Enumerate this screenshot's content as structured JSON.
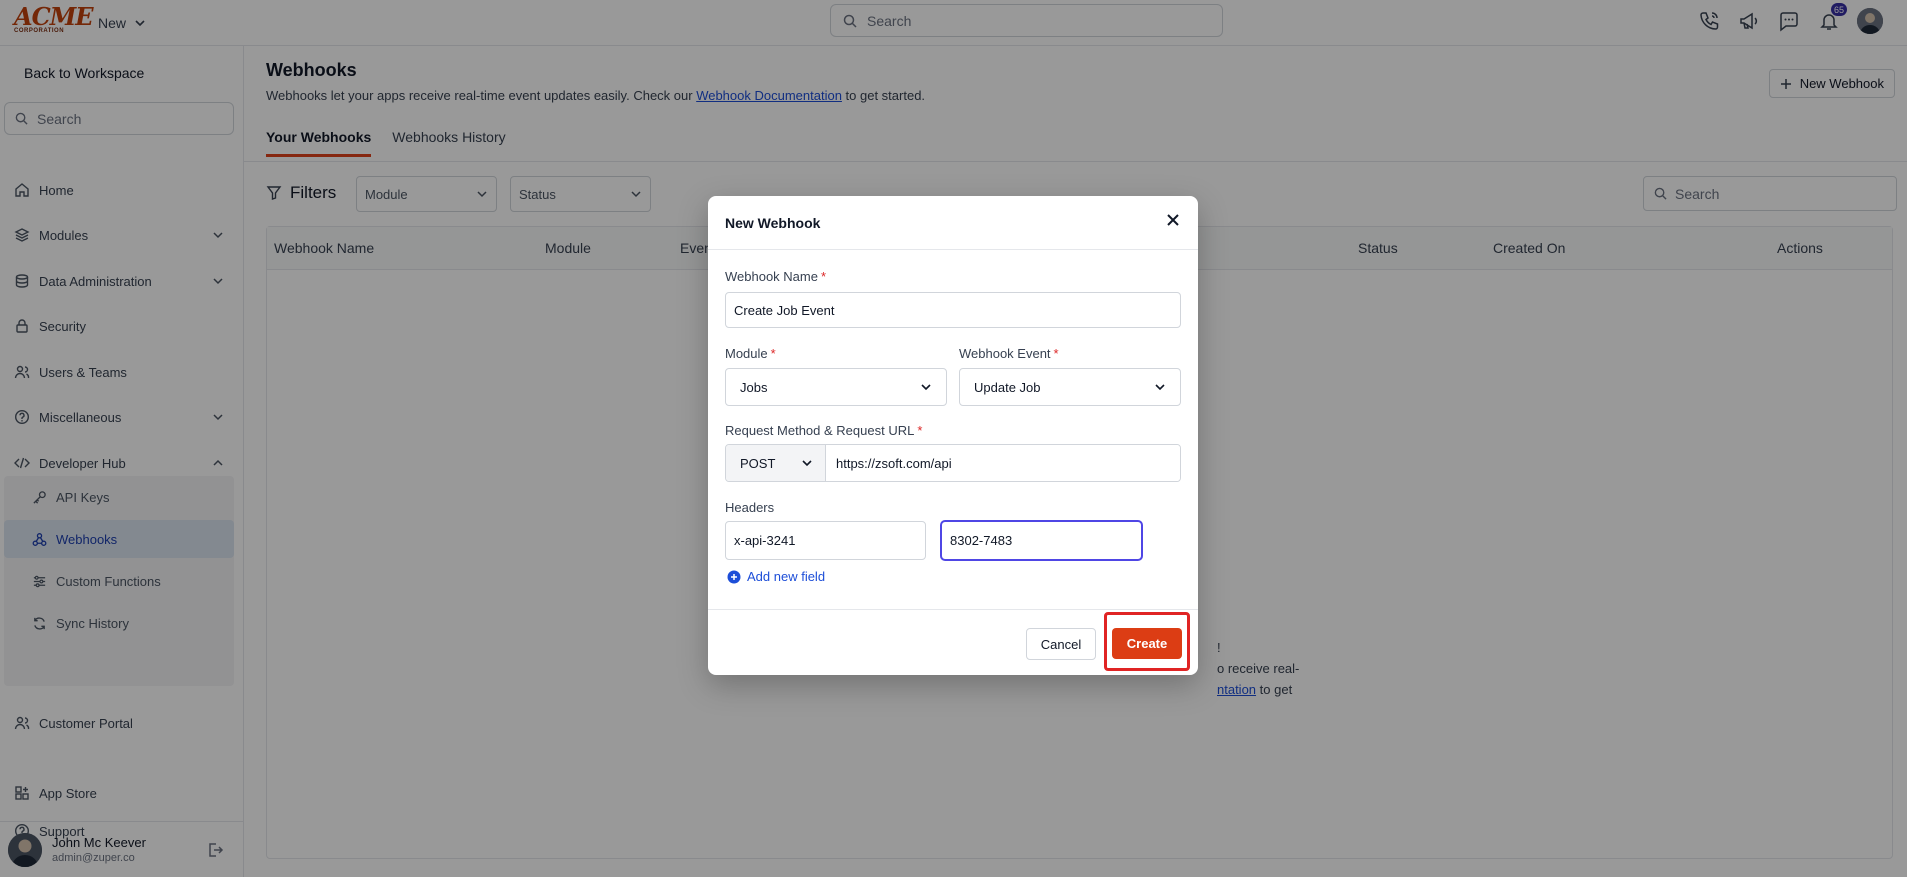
{
  "topbar": {
    "logo_main": "ACME",
    "logo_sub": "CORPORATION",
    "new_label": "New",
    "search_placeholder": "Search",
    "notification_count": "65"
  },
  "sidebar": {
    "back_label": "Back to Workspace",
    "search_placeholder": "Search",
    "items": [
      {
        "label": "Home"
      },
      {
        "label": "Modules"
      },
      {
        "label": "Data Administration"
      },
      {
        "label": "Security"
      },
      {
        "label": "Users & Teams"
      },
      {
        "label": "Miscellaneous"
      },
      {
        "label": "Developer Hub"
      },
      {
        "label": "Customer Portal"
      },
      {
        "label": "App Store"
      },
      {
        "label": "Support"
      }
    ],
    "sub_items": [
      {
        "label": "API Keys"
      },
      {
        "label": "Webhooks"
      },
      {
        "label": "Custom Functions"
      },
      {
        "label": "Sync History"
      }
    ],
    "user": {
      "name": "John Mc Keever",
      "email": "admin@zuper.co"
    }
  },
  "main": {
    "title": "Webhooks",
    "desc_pre": "Webhooks let your apps receive real-time event updates easily. Check our ",
    "desc_link": "Webhook Documentation",
    "desc_post": " to get started.",
    "new_button": "New Webhook",
    "tabs": [
      {
        "label": "Your Webhooks"
      },
      {
        "label": "Webhooks History"
      }
    ],
    "filters_label": "Filters",
    "filter_module": "Module",
    "filter_status": "Status",
    "search_placeholder": "Search",
    "columns": [
      "Webhook Name",
      "Module",
      "Event",
      "Status",
      "Created On",
      "Actions"
    ],
    "empty_line1": "!",
    "empty_line2": "o receive real-",
    "empty_link": "ntation",
    "empty_line3": " to get"
  },
  "modal": {
    "title": "New Webhook",
    "name_label": "Webhook Name",
    "name_value": "Create Job Event",
    "module_label": "Module",
    "module_value": "Jobs",
    "event_label": "Webhook Event",
    "event_value": "Update Job",
    "url_label": "Request Method & Request URL",
    "method_value": "POST",
    "url_value": "https://zsoft.com/api",
    "headers_label": "Headers",
    "header_key": "x-api-3241",
    "header_value": "8302-7483",
    "add_field": "Add new field",
    "cancel": "Cancel",
    "create": "Create"
  },
  "colors": {
    "accent": "#dc3d14",
    "highlight": "#e02424",
    "link": "#1d4ed8"
  }
}
